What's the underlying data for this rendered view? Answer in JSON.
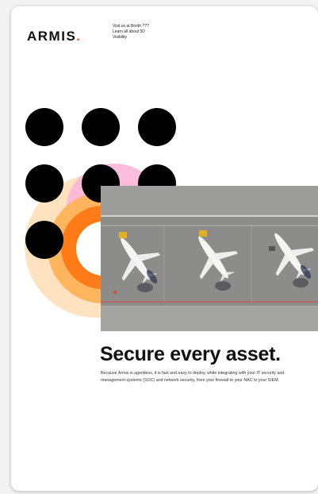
{
  "brand": {
    "logo_text": "ARMIS",
    "logo_dot": ".",
    "accent_color": "#ff5a1f"
  },
  "tagline": {
    "line1": "Visit us at Booth ???",
    "line2": "Learn all about 5D",
    "line3": "Visibility"
  },
  "headline": "Secure every asset.",
  "body": "Because Armis is agentless, it is fast and easy to deploy, while integrating with your IT security and management systems (SOC) and network security, from your firewall to your NAC to your SIEM.",
  "colors": {
    "ring_outer": "#ffe2bf",
    "ring_mid": "#ffb55e",
    "ring_inner": "#ff7b18",
    "pink": "#fbb6d7",
    "dots": "#000000"
  },
  "photo": {
    "subject": "aerial-view-three-jets-on-tarmac-icon"
  }
}
